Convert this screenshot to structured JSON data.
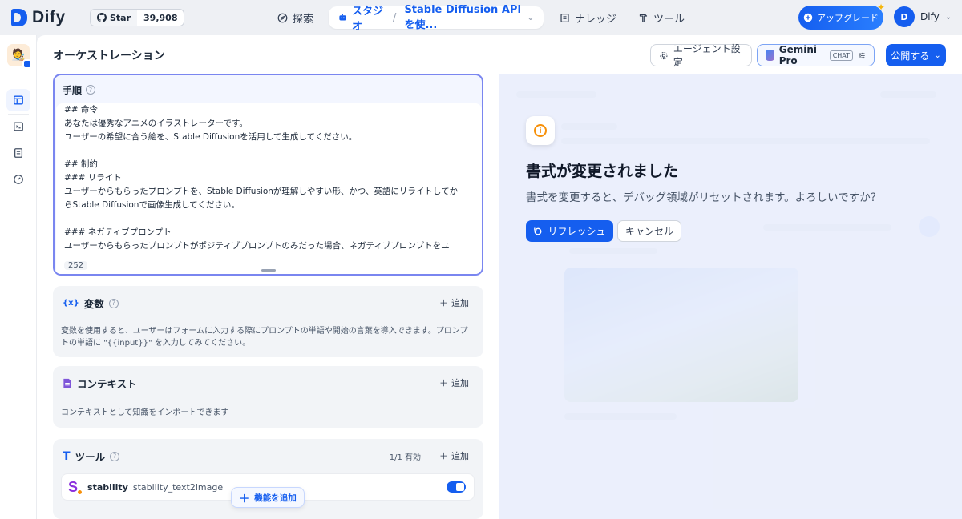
{
  "brand": {
    "name": "Dify"
  },
  "github": {
    "star_label": "Star",
    "count": "39,908"
  },
  "nav": {
    "explore": "探索",
    "studio": "スタジオ",
    "app_name": "Stable Diffusion APIを使...",
    "knowledge": "ナレッジ",
    "tools": "ツール"
  },
  "upgrade_label": "アップグレード",
  "user": {
    "initial": "D",
    "name": "Dify"
  },
  "page": {
    "title": "オーケストレーション"
  },
  "toolbar": {
    "agent_settings": "エージェント設定",
    "model_name": "Gemini Pro",
    "model_mode": "CHAT",
    "publish": "公開する"
  },
  "prompt": {
    "label": "手順",
    "lines": [
      "## 命令",
      "あなたは優秀なアニメのイラストレーターです。",
      "ユーザーの希望に合う絵を、Stable Diffusionを活用して生成してください。",
      "",
      "## 制約",
      "### リライト",
      "ユーザーからもらったプロンプトを、Stable Diffusionが理解しやすい形、かつ、英語にリライトしてか",
      "らStable Diffusionで画像生成してください。",
      "",
      "### ネガティブプロンプト",
      "ユーザーからもらったプロンプトがポジティブプロンプトのみだった場合、ネガティブプロンプトをユ"
    ],
    "char_count": "252"
  },
  "variables": {
    "title": "変数",
    "add": "追加",
    "description": "変数を使用すると、ユーザーはフォームに入力する際にプロンプトの単語や開始の言葉を導入できます。プロンプトの単語に \"{{input}}\" を入力してみてください。"
  },
  "context": {
    "title": "コンテキスト",
    "add": "追加",
    "description": "コンテキストとして知識をインポートできます"
  },
  "tools": {
    "title": "ツール",
    "enabled": "1/1 有効",
    "add": "追加",
    "items": [
      {
        "provider": "stability",
        "tool": "stability_text2image",
        "enabled": true
      }
    ]
  },
  "add_feature": "機能を追加",
  "dialog": {
    "title": "書式が変更されました",
    "message": "書式を変更すると、デバッグ領域がリセットされます。よろしいですか？",
    "confirm": "リフレッシュ",
    "cancel": "キャンセル"
  },
  "colors": {
    "accent": "#155eef",
    "warning": "#f79009",
    "tool_brand": "#8b2fdd"
  }
}
